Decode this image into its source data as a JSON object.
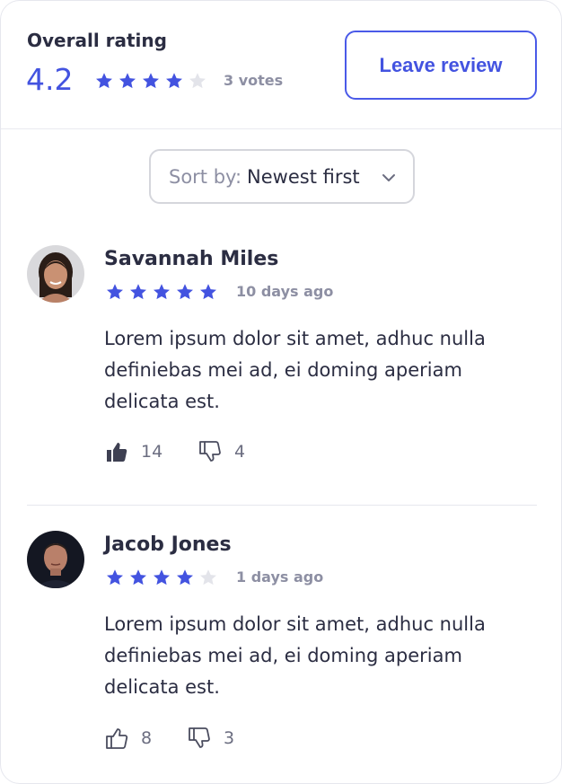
{
  "summary": {
    "label": "Overall rating",
    "score": "4.2",
    "votes": "3 votes",
    "stars": [
      "full",
      "full",
      "full",
      "full",
      "empty"
    ]
  },
  "actions": {
    "leave_review": "Leave review"
  },
  "sort": {
    "prefix": "Sort by:",
    "value": "Newest first"
  },
  "reviews": [
    {
      "name": "Savannah Miles",
      "date": "10 days ago",
      "rating": 5,
      "text": "Lorem ipsum dolor sit amet, adhuc nulla definiebas mei ad, ei doming aperiam delicata est.",
      "likes": "14",
      "dislikes": "4",
      "liked": true
    },
    {
      "name": "Jacob Jones",
      "date": "1 days ago",
      "rating": 4,
      "text": "Lorem ipsum dolor sit amet, adhuc nulla definiebas mei ad, ei doming aperiam delicata est.",
      "likes": "8",
      "dislikes": "3",
      "liked": false
    }
  ],
  "colors": {
    "accent": "#4353e0",
    "star_filled": "#4353e0",
    "star_empty": "#e3e4ea",
    "muted_text": "#8d8fa3",
    "text": "#2b2d42"
  }
}
